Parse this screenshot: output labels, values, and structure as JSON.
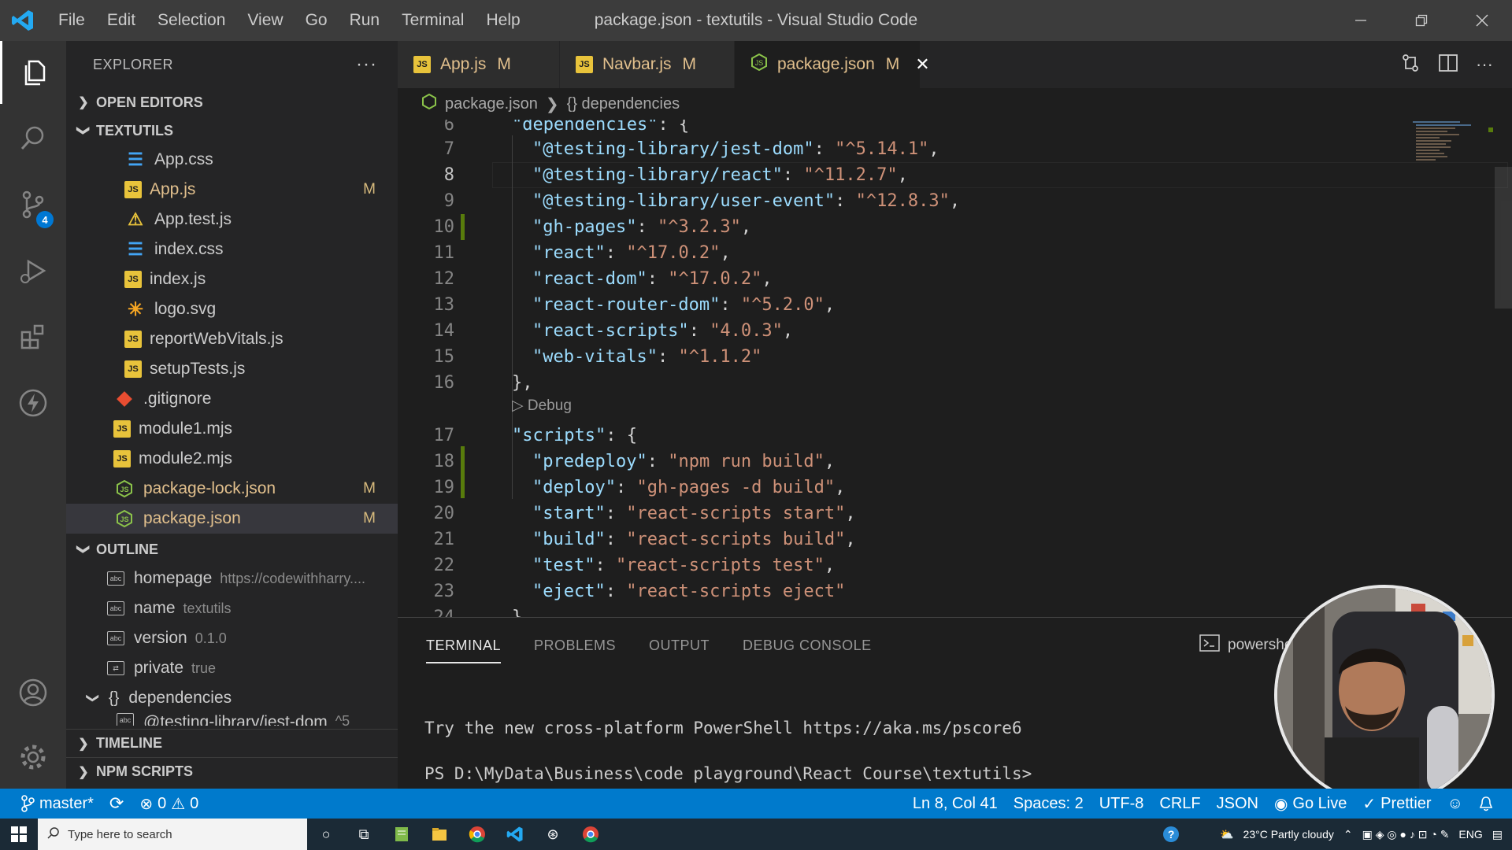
{
  "window": {
    "title": "package.json - textutils - Visual Studio Code",
    "menu": [
      "File",
      "Edit",
      "Selection",
      "View",
      "Go",
      "Run",
      "Terminal",
      "Help"
    ]
  },
  "activity": {
    "scm_badge": "4"
  },
  "sidebar": {
    "header": "EXPLORER",
    "more": "···",
    "open_editors": "OPEN EDITORS",
    "project": "TEXTUTILS",
    "files": [
      {
        "name": "App.css",
        "icon": "css-icon",
        "mark": ""
      },
      {
        "name": "App.js",
        "icon": "js-icon",
        "mark": "M"
      },
      {
        "name": "App.test.js",
        "icon": "test-icon",
        "mark": ""
      },
      {
        "name": "index.css",
        "icon": "css-icon",
        "mark": ""
      },
      {
        "name": "index.js",
        "icon": "js-icon",
        "mark": ""
      },
      {
        "name": "logo.svg",
        "icon": "svg-icon",
        "mark": ""
      },
      {
        "name": "reportWebVitals.js",
        "icon": "js-icon",
        "mark": ""
      },
      {
        "name": "setupTests.js",
        "icon": "js-icon",
        "mark": ""
      },
      {
        "name": ".gitignore",
        "icon": "git-icon",
        "mark": ""
      },
      {
        "name": "module1.mjs",
        "icon": "js-icon",
        "mark": ""
      },
      {
        "name": "module2.mjs",
        "icon": "js-icon",
        "mark": ""
      },
      {
        "name": "package-lock.json",
        "icon": "json-icon",
        "mark": "M"
      },
      {
        "name": "package.json",
        "icon": "json-icon",
        "mark": "M"
      }
    ],
    "outline_title": "OUTLINE",
    "outline": [
      {
        "name": "homepage",
        "value": "https://codewithharry...."
      },
      {
        "name": "name",
        "value": "textutils"
      },
      {
        "name": "version",
        "value": "0.1.0"
      },
      {
        "name": "private",
        "value": "true"
      },
      {
        "name": "dependencies",
        "value": ""
      },
      {
        "name": "@testing-library/jest-dom",
        "value": "^5"
      }
    ],
    "timeline": "TIMELINE",
    "npm_scripts": "NPM SCRIPTS"
  },
  "tabs": [
    {
      "label": "App.js",
      "mark": "M"
    },
    {
      "label": "Navbar.js",
      "mark": "M"
    },
    {
      "label": "package.json",
      "mark": "M",
      "close": "✕"
    }
  ],
  "breadcrumb": {
    "file": "package.json",
    "symbol": "{} dependencies"
  },
  "editor": {
    "lines": [
      {
        "n": "6",
        "key": "\"dependencies\"",
        "val": "",
        "open": ": {"
      },
      {
        "n": "7",
        "key": "\"@testing-library/jest-dom\"",
        "val": "\"^5.14.1\"",
        "open": ""
      },
      {
        "n": "8",
        "key": "\"@testing-library/react\"",
        "val": "\"^11.2.7\"",
        "open": ""
      },
      {
        "n": "9",
        "key": "\"@testing-library/user-event\"",
        "val": "\"^12.8.3\"",
        "open": ""
      },
      {
        "n": "10",
        "key": "\"gh-pages\"",
        "val": "\"^3.2.3\"",
        "open": ""
      },
      {
        "n": "11",
        "key": "\"react\"",
        "val": "\"^17.0.2\"",
        "open": ""
      },
      {
        "n": "12",
        "key": "\"react-dom\"",
        "val": "\"^17.0.2\"",
        "open": ""
      },
      {
        "n": "13",
        "key": "\"react-router-dom\"",
        "val": "\"^5.2.0\"",
        "open": ""
      },
      {
        "n": "14",
        "key": "\"react-scripts\"",
        "val": "\"4.0.3\"",
        "open": ""
      },
      {
        "n": "15",
        "key": "\"web-vitals\"",
        "val": "\"^1.1.2\"",
        "open": ""
      },
      {
        "n": "16",
        "text": "},"
      },
      {
        "codelens": "▷ Debug"
      },
      {
        "n": "17",
        "key": "\"scripts\"",
        "val": "",
        "open": ": {"
      },
      {
        "n": "18",
        "key": "\"predeploy\"",
        "val": "\"npm run build\"",
        "open": ""
      },
      {
        "n": "19",
        "key": "\"deploy\"",
        "val": "\"gh-pages -d build\"",
        "open": ""
      },
      {
        "n": "20",
        "key": "\"start\"",
        "val": "\"react-scripts start\"",
        "open": ""
      },
      {
        "n": "21",
        "key": "\"build\"",
        "val": "\"react-scripts build\"",
        "open": ""
      },
      {
        "n": "22",
        "key": "\"test\"",
        "val": "\"react-scripts test\"",
        "open": ""
      },
      {
        "n": "23",
        "key": "\"eject\"",
        "val": "\"react-scripts eject\"",
        "open": ""
      },
      {
        "n": "24",
        "text": "},"
      }
    ]
  },
  "panel": {
    "tabs": [
      "TERMINAL",
      "PROBLEMS",
      "OUTPUT",
      "DEBUG CONSOLE"
    ],
    "shell": "powershe",
    "output": [
      "Try the new cross-platform PowerShell https://aka.ms/pscore6",
      "PS D:\\MyData\\Business\\code playground\\React Course\\textutils>"
    ]
  },
  "status": {
    "branch": "master*",
    "errors": "0",
    "warnings": "0",
    "position": "Ln 8, Col 41",
    "spaces": "Spaces: 2",
    "encoding": "UTF-8",
    "eol": "CRLF",
    "language": "JSON",
    "golive": "Go Live",
    "prettier": "Prettier"
  },
  "taskbar": {
    "search_placeholder": "Type here to search",
    "weather": "23°C  Partly cloudy",
    "lang": "ENG"
  },
  "colors": {
    "accent": "#007acc",
    "modified": "#e2c08d",
    "string": "#ce9178",
    "key": "#9cdcfe"
  }
}
